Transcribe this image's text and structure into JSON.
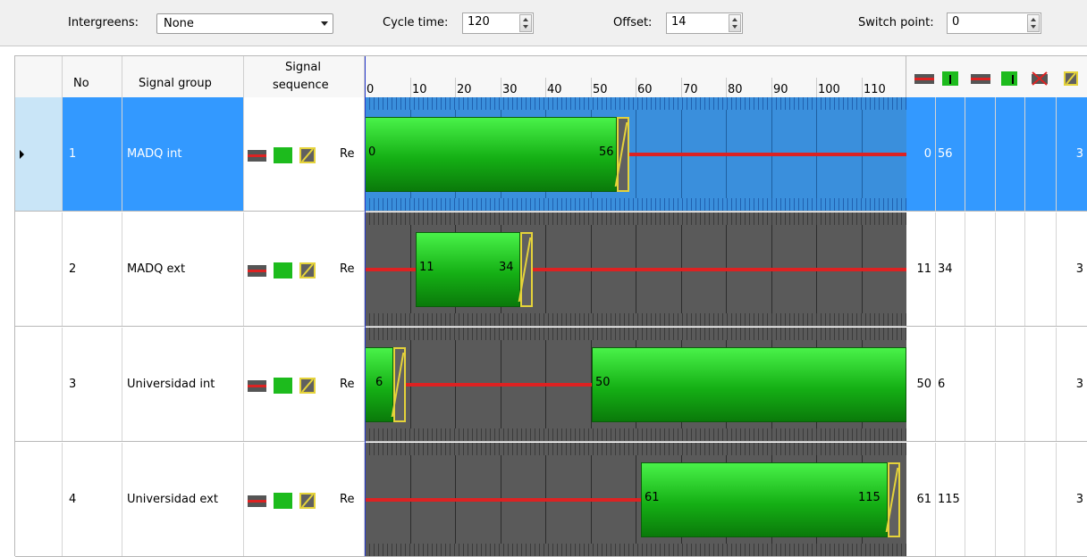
{
  "toolbar": {
    "intergreens_label": "Intergreens:",
    "intergreens_value": "None",
    "cycle_label": "Cycle time:",
    "cycle_value": "120",
    "offset_label": "Offset:",
    "offset_value": "14",
    "switch_label": "Switch point:",
    "switch_value": "0"
  },
  "header": {
    "no": "No",
    "signal_group": "Signal group",
    "signal_sequence_1": "Signal",
    "signal_sequence_2": "sequence",
    "ticks": [
      "0",
      "10",
      "20",
      "30",
      "40",
      "50",
      "60",
      "70",
      "80",
      "90",
      "100",
      "110"
    ],
    "icon_names": [
      "red-end-icon",
      "green-end-icon",
      "red-start-icon",
      "green-start-icon",
      "red-cross-icon",
      "amber-icon"
    ]
  },
  "rows": [
    {
      "no": "1",
      "name": "MADQ int",
      "seq": "Re",
      "green_start": "0",
      "green_end": "56",
      "col_a": "0",
      "col_b": "56",
      "col_last": "3"
    },
    {
      "no": "2",
      "name": "MADQ ext",
      "seq": "Re",
      "green_start": "11",
      "green_end": "34",
      "col_a": "11",
      "col_b": "34",
      "col_last": "3"
    },
    {
      "no": "3",
      "name": "Universidad int",
      "seq": "Re",
      "green_start": "50",
      "green_end": "6",
      "col_a": "50",
      "col_b": "6",
      "col_last": "3"
    },
    {
      "no": "4",
      "name": "Universidad ext",
      "seq": "Re",
      "green_start": "61",
      "green_end": "115",
      "col_a": "61",
      "col_b": "115",
      "col_last": "3"
    }
  ],
  "colors": {
    "selection": "#3399ff",
    "green": "#22c422",
    "red": "#dd2222",
    "amber": "#e5d33a"
  }
}
